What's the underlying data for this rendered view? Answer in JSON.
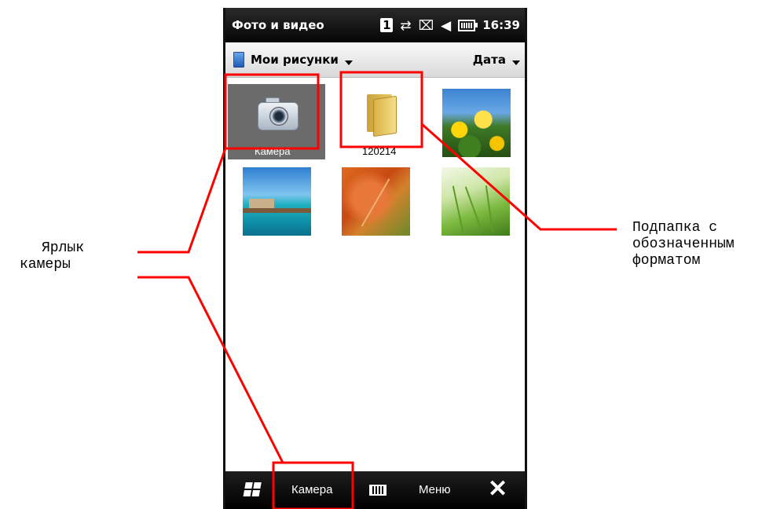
{
  "status_bar": {
    "title": "Фото и видео",
    "icons": [
      "notification-1-icon",
      "sync-icon",
      "signal-off-icon",
      "volume-mute-icon",
      "battery-icon"
    ],
    "notification_count": "1",
    "time": "16:39"
  },
  "toolbar": {
    "folder_label": "Мои рисунки",
    "sort_label": "Дата"
  },
  "grid": {
    "tiles": [
      {
        "type": "shortcut",
        "label": "Камера",
        "icon": "camera-icon",
        "selected": true
      },
      {
        "type": "folder",
        "label": "120214",
        "icon": "folder-icon"
      },
      {
        "type": "photo",
        "subject": "yellow flowers"
      },
      {
        "type": "photo",
        "subject": "tropical beach"
      },
      {
        "type": "photo",
        "subject": "autumn leaf"
      },
      {
        "type": "photo",
        "subject": "grass"
      }
    ]
  },
  "softkeys": {
    "start_icon": "windows-start-icon",
    "left_label": "Камера",
    "keyboard_icon": "keyboard-icon",
    "right_label": "Меню",
    "close_icon": "close-icon"
  },
  "annotations": {
    "camera_shortcut": [
      "Ярлык",
      "камеры"
    ],
    "subfolder": [
      "Подпапка с",
      "обозначенным",
      "форматом"
    ]
  },
  "colors": {
    "highlight_outline": "#ff0000",
    "selected_tile_bg": "#6b6b6b",
    "bar_bg": "#000000"
  }
}
